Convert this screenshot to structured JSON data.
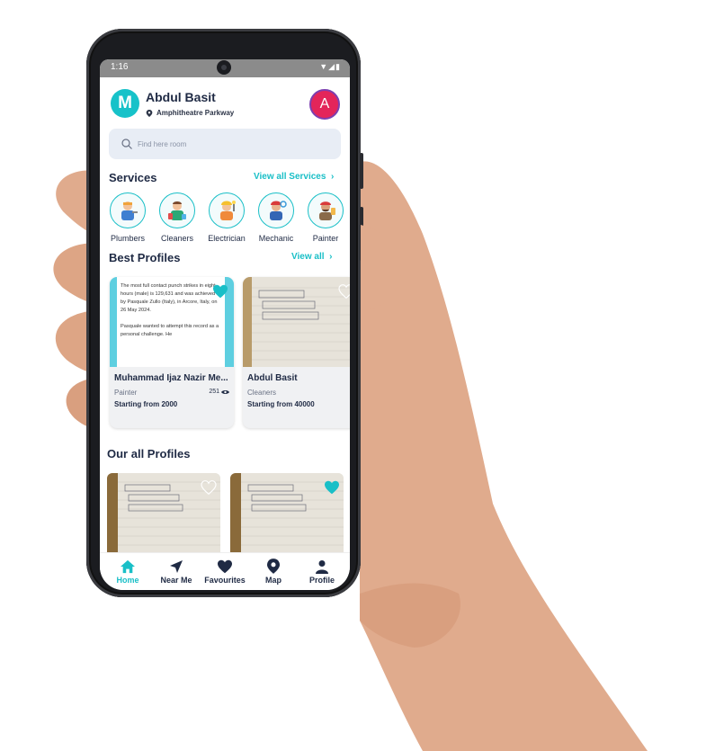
{
  "status_bar": {
    "time": "1:16"
  },
  "header": {
    "logo_letter": "M",
    "user_name": "Abdul Basit",
    "location": "Amphitheatre Parkway",
    "avatar_letter": "A"
  },
  "search": {
    "placeholder": "Find here room"
  },
  "services": {
    "title": "Services",
    "view_all": "View all Services",
    "items": [
      {
        "label": "Plumbers",
        "icon": "plumber-icon"
      },
      {
        "label": "Cleaners",
        "icon": "cleaner-icon"
      },
      {
        "label": "Electrician",
        "icon": "electrician-icon"
      },
      {
        "label": "Mechanic",
        "icon": "mechanic-icon"
      },
      {
        "label": "Painter",
        "icon": "painter-icon"
      }
    ]
  },
  "best_profiles": {
    "title": "Best Profiles",
    "view_all": "View all",
    "cards": [
      {
        "name": "Muhammad Ijaz Nazir Me...",
        "category": "Painter",
        "views": "251",
        "price": "Starting from 2000",
        "favorited": true,
        "image_text_1": "The most full contact punch strikes in eight hours (male) is 129,631 and was achieved by Pasquale Zullo (Italy), in Arcore, Italy, on 26 May 2024.",
        "image_text_2": "Pasquale wanted to attempt this record as a personal challenge. He"
      },
      {
        "name": "Abdul Basit",
        "category": "Cleaners",
        "price": "Starting from 40000",
        "favorited": false
      }
    ]
  },
  "all_profiles": {
    "title": "Our all Profiles"
  },
  "bottom_nav": {
    "items": [
      {
        "label": "Home",
        "icon": "home-icon",
        "active": true
      },
      {
        "label": "Near Me",
        "icon": "navigation-arrow-icon",
        "active": false
      },
      {
        "label": "Favourites",
        "icon": "heart-icon",
        "active": false
      },
      {
        "label": "Map",
        "icon": "map-pin-icon",
        "active": false
      },
      {
        "label": "Profile",
        "icon": "person-icon",
        "active": false
      }
    ]
  },
  "colors": {
    "accent": "#19bfc7",
    "text_dark": "#1f2a44",
    "avatar_bg": "#e3255a",
    "search_bg": "#e8edf5"
  }
}
